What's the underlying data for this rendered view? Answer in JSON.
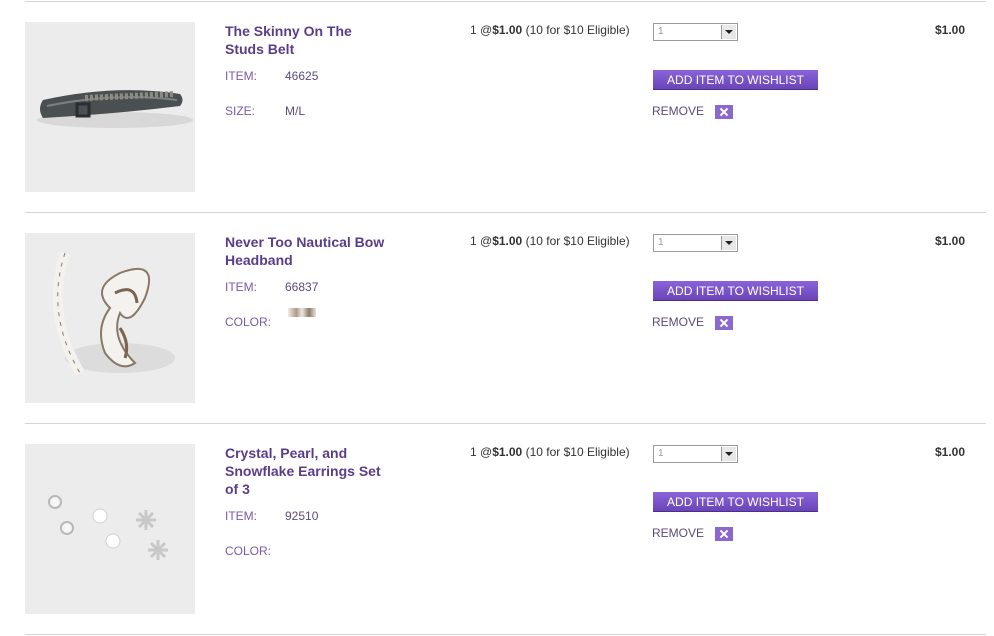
{
  "cart": {
    "items": [
      {
        "name": "The Skinny On The Studs Belt",
        "item_label": "ITEM:",
        "item_number": "46625",
        "attr_label": "SIZE:",
        "attr_value": "M/L",
        "price_qty": "1 @",
        "price_amount": "$1.00",
        "price_note": "(10 for $10 Eligible)",
        "qty_value": "1",
        "wishlist_label": "ADD ITEM TO WISHLIST",
        "remove_label": "REMOVE",
        "total": "$1.00",
        "image_icon": "belt-image"
      },
      {
        "name": "Never Too Nautical Bow Headband",
        "item_label": "ITEM:",
        "item_number": "66837",
        "attr_label": "COLOR:",
        "attr_value": "",
        "price_qty": "1 @",
        "price_amount": "$1.00",
        "price_note": "(10 for $10 Eligible)",
        "qty_value": "1",
        "wishlist_label": "ADD ITEM TO WISHLIST",
        "remove_label": "REMOVE",
        "total": "$1.00",
        "image_icon": "headband-image"
      },
      {
        "name": "Crystal, Pearl, and Snowflake Earrings Set of 3",
        "item_label": "ITEM:",
        "item_number": "92510",
        "attr_label": "COLOR:",
        "attr_value": "",
        "price_qty": "1 @",
        "price_amount": "$1.00",
        "price_note": "(10 for $10 Eligible)",
        "qty_value": "1",
        "wishlist_label": "ADD ITEM TO WISHLIST",
        "remove_label": "REMOVE",
        "total": "$1.00",
        "image_icon": "earrings-image"
      }
    ]
  },
  "colors": {
    "accent": "#6a45b8",
    "product_name": "#5a3d8a",
    "divider": "#d6d3dc"
  }
}
